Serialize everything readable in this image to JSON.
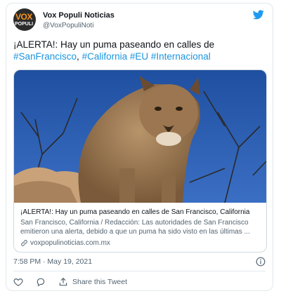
{
  "author": {
    "name": "Vox Populi Noticias",
    "handle": "@VoxPopuliNoti",
    "avatar_logo_text": "VOX",
    "avatar_logo_subtext": "POPULI"
  },
  "tweet": {
    "text_prefix": "¡ALERTA!: Hay un puma paseando en calles de",
    "hashtags": [
      "#SanFrancisco",
      "#California",
      "#EU",
      "#Internacional"
    ],
    "timestamp": "7:58 PM · May 19, 2021"
  },
  "card": {
    "title": "¡ALERTA!: Hay un puma paseando en calles de San Francisco, California",
    "description": "San Francisco, California / Redacción: Las autoridades de San Francisco emitieron una alerta, debido a que un puma ha sido visto en las últimas ...",
    "domain": "voxpopulinoticias.com.mx"
  },
  "actions": {
    "share_label": "Share this Tweet"
  },
  "colors": {
    "link": "#1b95e0",
    "muted": "#536471",
    "border": "#e1e8ed"
  },
  "icons": [
    "twitter-bird-icon",
    "link-icon",
    "info-icon",
    "heart-icon",
    "reply-icon",
    "share-icon"
  ]
}
